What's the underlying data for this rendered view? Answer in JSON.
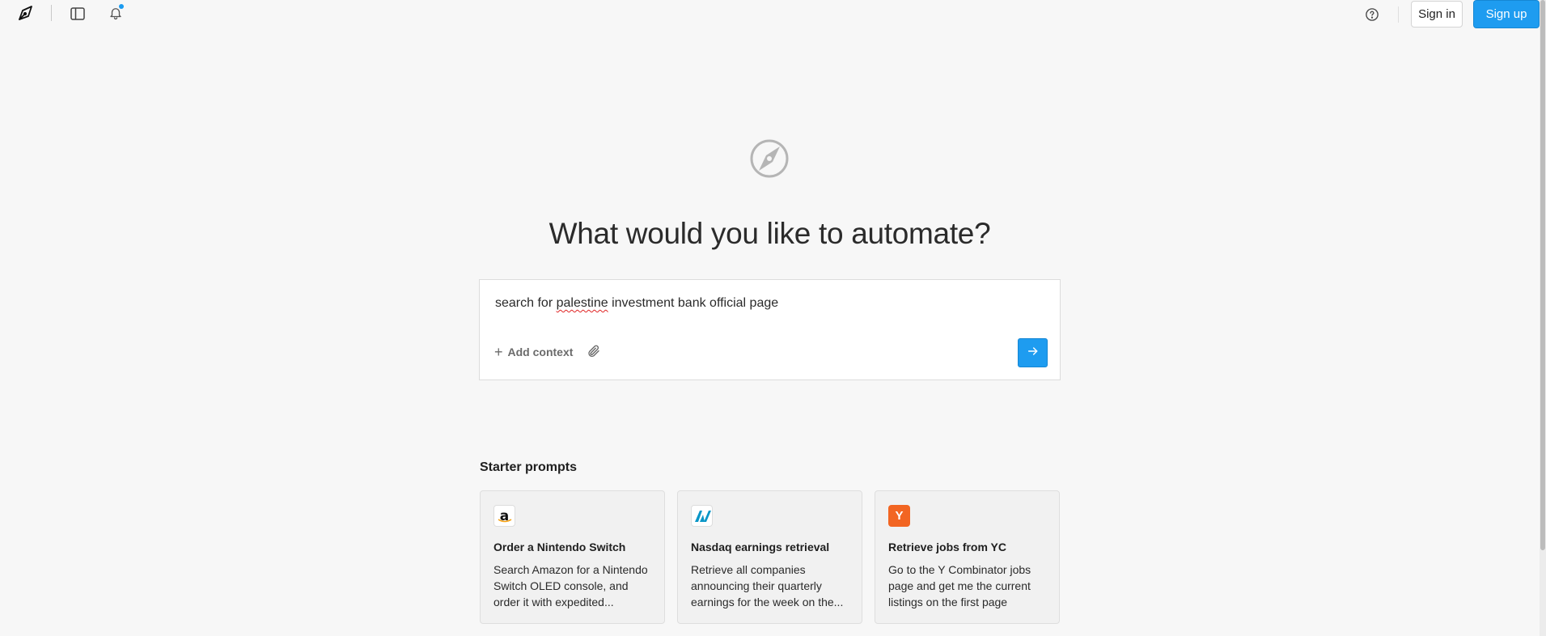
{
  "topbar": {
    "logo_icon": "compass-pen-icon",
    "sidebar_icon": "sidebar-toggle-icon",
    "notifications_icon": "bell-icon",
    "help_icon": "help-circle-icon",
    "signin_label": "Sign in",
    "signup_label": "Sign up"
  },
  "hero": {
    "icon": "compass-icon",
    "headline": "What would you like to automate?"
  },
  "prompt": {
    "text_before": "search for ",
    "text_misspelled": "palestine",
    "text_after": " investment bank official page",
    "add_context_label": "Add context",
    "attach_icon": "paperclip-icon",
    "send_icon": "arrow-right-icon"
  },
  "starter": {
    "title": "Starter prompts",
    "cards": [
      {
        "icon": "amazon-icon",
        "icon_glyph": "a",
        "title": "Order a Nintendo Switch",
        "description": "Search Amazon for a Nintendo Switch OLED console, and order it with expedited..."
      },
      {
        "icon": "nasdaq-icon",
        "icon_glyph": "",
        "title": "Nasdaq earnings retrieval",
        "description": "Retrieve all companies announcing their quarterly earnings for the week on the..."
      },
      {
        "icon": "ycombinator-icon",
        "icon_glyph": "Y",
        "title": "Retrieve jobs from YC",
        "description": "Go to the Y Combinator jobs page and get me the current listings on the first page"
      }
    ]
  },
  "colors": {
    "accent": "#1e9cf0",
    "background": "#f7f7f7",
    "yc_orange": "#f26522",
    "nasdaq_teal": "#0996c7"
  }
}
